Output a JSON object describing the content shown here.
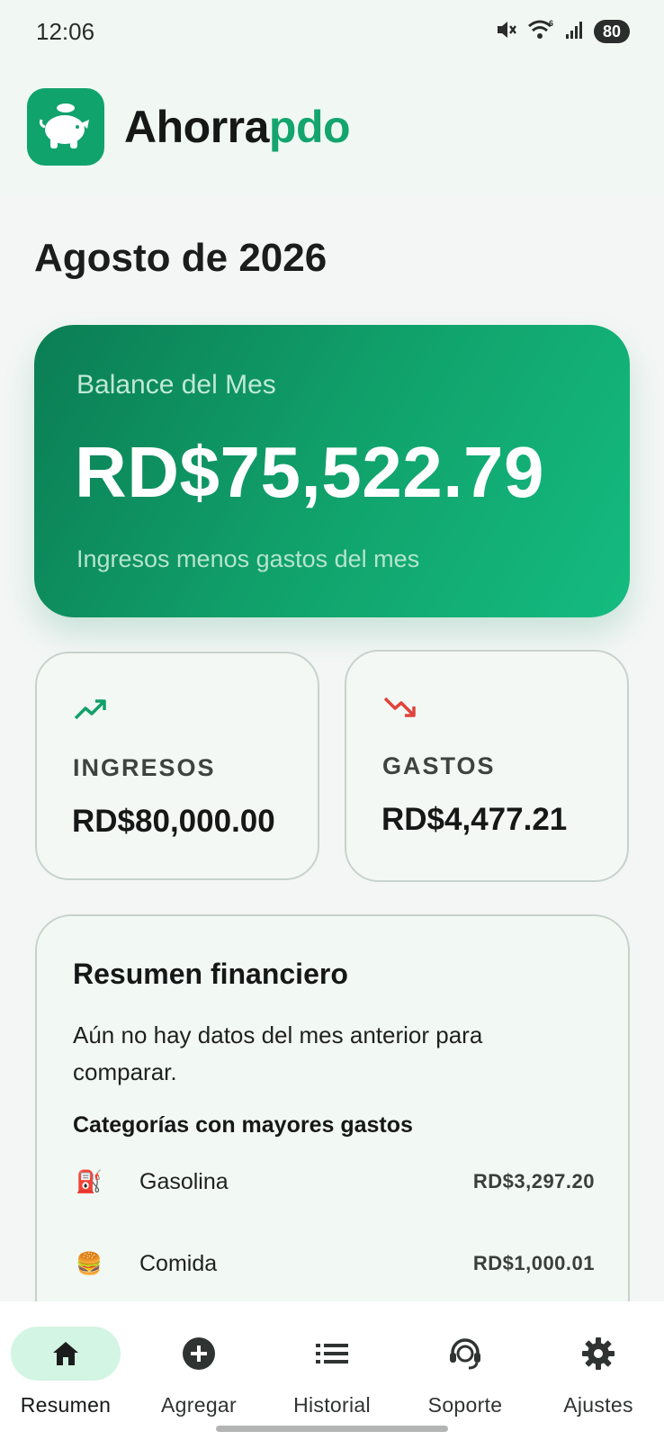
{
  "status_bar": {
    "time": "12:06",
    "battery": "80",
    "icons": [
      "mute-icon",
      "wifi-icon",
      "signal-icon",
      "battery-icon"
    ]
  },
  "header": {
    "app_name_part1": "Ahorra",
    "app_name_part2": "pdo",
    "logo_icon": "piggy-bank-icon"
  },
  "month_title": "Agosto de 2026",
  "balance": {
    "label": "Balance del Mes",
    "amount": "RD$75,522.79",
    "note": "Ingresos menos gastos del mes"
  },
  "income": {
    "label": "INGRESOS",
    "value": "RD$80,000.00",
    "icon": "trending-up-icon"
  },
  "expenses": {
    "label": "GASTOS",
    "value": "RD$4,477.21",
    "icon": "trending-down-icon"
  },
  "summary": {
    "title": "Resumen financiero",
    "text": "Aún no hay datos del mes anterior para comparar.",
    "subtitle": "Categorías con mayores gastos",
    "categories": [
      {
        "emoji": "⛽",
        "name": "Gasolina",
        "amount": "RD$3,297.20"
      },
      {
        "emoji": "🍔",
        "name": "Comida",
        "amount": "RD$1,000.01"
      }
    ]
  },
  "nav": [
    {
      "label": "Resumen",
      "icon": "home-icon",
      "active": true
    },
    {
      "label": "Agregar",
      "icon": "add-circle-icon",
      "active": false
    },
    {
      "label": "Historial",
      "icon": "list-icon",
      "active": false
    },
    {
      "label": "Soporte",
      "icon": "headset-icon",
      "active": false
    },
    {
      "label": "Ajustes",
      "icon": "gear-icon",
      "active": false
    }
  ],
  "colors": {
    "brand": "#14a56e",
    "income": "#12a06a",
    "expense": "#e0443c",
    "nav_active": "#d3f5e3"
  }
}
